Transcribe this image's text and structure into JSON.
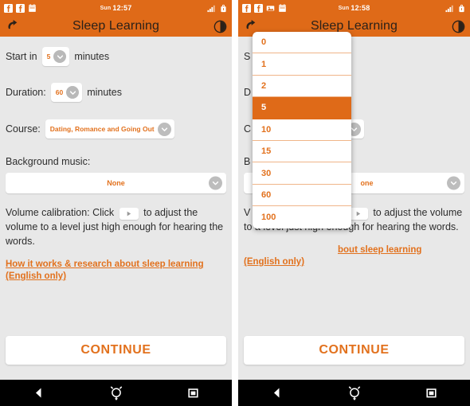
{
  "app": {
    "title": "Sleep Learning",
    "accent_orange": "#df6a18",
    "accent_text_orange": "#e2711d",
    "body_background": "#e8e8e8",
    "nav_background": "#000000",
    "title_text_color": "#2b2119"
  },
  "panels": [
    {
      "id": "left",
      "status": {
        "day": "Sun",
        "time": "12:57",
        "left_icons": [
          "facebook-icon",
          "facebook-icon",
          "calendar-icon"
        ],
        "right_icons": [
          "signal-icon",
          "battery-icon"
        ]
      },
      "toolbar": {
        "back_icon": "back-arrow-icon",
        "title": "Sleep Learning",
        "contrast_icon": "contrast-icon"
      },
      "form": {
        "start_in_label": "Start in",
        "start_in_value": "5",
        "start_in_unit": "minutes",
        "duration_label": "Duration:",
        "duration_value": "60",
        "duration_unit": "minutes",
        "course_label": "Course:",
        "course_value": "Dating, Romance and Going Out",
        "background_music_label": "Background music:",
        "background_music_value": "None",
        "calibration_text_1": "Volume calibration: Click",
        "calibration_text_2": "to adjust the volume to a level just high enough for hearing the words.",
        "play_icon": "play-icon",
        "info_link_line1": "How it works & research about sleep learning",
        "info_link_line2": "(English only)"
      },
      "continue_label": "CONTINUE",
      "nav": {
        "back_icon": "nav-back-icon",
        "home_icon": "nav-home-icon",
        "recents_icon": "nav-recents-icon"
      },
      "dropdown_open": false
    },
    {
      "id": "right",
      "status": {
        "day": "Sun",
        "time": "12:58",
        "left_icons": [
          "facebook-icon",
          "facebook-icon",
          "image-icon",
          "calendar-icon"
        ],
        "right_icons": [
          "signal-icon",
          "battery-icon"
        ]
      },
      "toolbar": {
        "back_icon": "back-arrow-icon",
        "title": "Sleep Learning",
        "contrast_icon": "contrast-icon"
      },
      "form": {
        "start_in_label": "S",
        "start_in_value": "5",
        "start_in_unit": "",
        "duration_label": "D",
        "duration_value": "60",
        "duration_unit": "",
        "course_label": "C",
        "course_value": "oing Out",
        "background_music_label": "B",
        "background_music_value": "one",
        "calibration_text_1": "V",
        "calibration_text_2": "to adjust the volume to a level just high enough for hearing the words.",
        "play_icon": "play-icon",
        "info_link_line1": "bout sleep learning",
        "info_link_line2": "(English only)"
      },
      "continue_label": "CONTINUE",
      "nav": {
        "back_icon": "nav-back-icon",
        "home_icon": "nav-home-icon",
        "recents_icon": "nav-recents-icon"
      },
      "dropdown_open": true
    }
  ],
  "dropdown": {
    "name": "start-in-options",
    "selected": "5",
    "options": [
      "0",
      "1",
      "2",
      "5",
      "10",
      "15",
      "30",
      "60",
      "100"
    ],
    "selected_background": "#df6a18",
    "selected_text_color": "#ffffff",
    "option_text_color": "#e2711d"
  }
}
